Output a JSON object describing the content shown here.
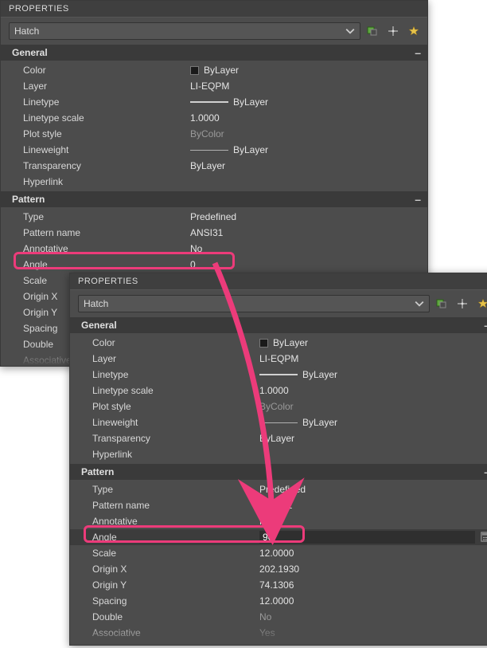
{
  "panel1": {
    "title": "PROPERTIES",
    "selector": "Hatch",
    "groups": {
      "general": {
        "label": "General",
        "rows": [
          {
            "k": "Color",
            "v": "ByLayer",
            "swatch": true
          },
          {
            "k": "Layer",
            "v": "LI-EQPM"
          },
          {
            "k": "Linetype",
            "v": "ByLayer",
            "ltype": true
          },
          {
            "k": "Linetype scale",
            "v": "1.0000"
          },
          {
            "k": "Plot style",
            "v": "ByColor",
            "dim": true
          },
          {
            "k": "Lineweight",
            "v": "ByLayer",
            "lw": true
          },
          {
            "k": "Transparency",
            "v": "ByLayer"
          },
          {
            "k": "Hyperlink",
            "v": ""
          }
        ]
      },
      "pattern": {
        "label": "Pattern",
        "rows": [
          {
            "k": "Type",
            "v": "Predefined"
          },
          {
            "k": "Pattern name",
            "v": "ANSI31"
          },
          {
            "k": "Annotative",
            "v": "No"
          },
          {
            "k": "Angle",
            "v": "0"
          },
          {
            "k": "Scale",
            "v": ""
          },
          {
            "k": "Origin X",
            "v": ""
          },
          {
            "k": "Origin Y",
            "v": ""
          },
          {
            "k": "Spacing",
            "v": ""
          },
          {
            "k": "Double",
            "v": ""
          },
          {
            "k": "Associative",
            "v": ""
          }
        ]
      }
    }
  },
  "panel2": {
    "title": "PROPERTIES",
    "selector": "Hatch",
    "groups": {
      "general": {
        "label": "General",
        "rows": [
          {
            "k": "Color",
            "v": "ByLayer",
            "swatch": true
          },
          {
            "k": "Layer",
            "v": "LI-EQPM"
          },
          {
            "k": "Linetype",
            "v": "ByLayer",
            "ltype": true
          },
          {
            "k": "Linetype scale",
            "v": "1.0000"
          },
          {
            "k": "Plot style",
            "v": "ByColor",
            "dim": true
          },
          {
            "k": "Lineweight",
            "v": "ByLayer",
            "lw": true
          },
          {
            "k": "Transparency",
            "v": "ByLayer"
          },
          {
            "k": "Hyperlink",
            "v": ""
          }
        ]
      },
      "pattern": {
        "label": "Pattern",
        "rows": [
          {
            "k": "Type",
            "v": "Predefined"
          },
          {
            "k": "Pattern name",
            "v": "ANSI31"
          },
          {
            "k": "Annotative",
            "v": "No"
          },
          {
            "k": "Angle",
            "v": "90",
            "active": true
          },
          {
            "k": "Scale",
            "v": "12.0000"
          },
          {
            "k": "Origin X",
            "v": "202.1930"
          },
          {
            "k": "Origin Y",
            "v": "74.1306"
          },
          {
            "k": "Spacing",
            "v": "12.0000"
          },
          {
            "k": "Double",
            "v": "No",
            "dim": true
          },
          {
            "k": "Associative",
            "v": "Yes",
            "dim": true
          }
        ]
      }
    }
  },
  "icons": {
    "pim": "pim-icon",
    "quick": "quick-select-icon",
    "star": "toggle-icon"
  }
}
